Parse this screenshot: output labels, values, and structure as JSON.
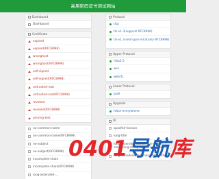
{
  "header": {
    "title": "高用密码证书测试网站"
  },
  "dashboard": {
    "heading": "Dashboard",
    "items": [
      {
        "label": "Dashboard"
      }
    ]
  },
  "certificate": {
    "heading": "Certificate",
    "items": [
      {
        "label": "expired"
      },
      {
        "label": "expired(RFC8998)"
      },
      {
        "label": "wronghost"
      },
      {
        "label": "wronghost(RFC8998)"
      },
      {
        "label": "self-signed"
      },
      {
        "label": "self-signed(RFC8998)"
      },
      {
        "label": "untrusted-root"
      },
      {
        "label": "untrusted-root(RFC8998)"
      },
      {
        "label": "revoked"
      },
      {
        "label": "revoked(RFC8998)"
      },
      {
        "label": "pinning-test"
      }
    ]
  },
  "name_list": {
    "items": [
      {
        "label": "no-common-name"
      },
      {
        "label": "no-common-name(RFC8998)"
      },
      {
        "label": "no-subject"
      },
      {
        "label": "no-subject(RFC8998)"
      },
      {
        "label": "incomplete-chain"
      },
      {
        "label": "incomplete-chain(RFC8998)"
      },
      {
        "label": "long-extended-..."
      }
    ]
  },
  "protocol": {
    "heading": "Protocol",
    "items": [
      {
        "label": "tlcp"
      },
      {
        "label": "tls-v1.3(support RFC8998)"
      },
      {
        "label": "tls-v1.3-sm4-gcm-sm3(only RFC8998)"
      }
    ]
  },
  "upper_protocol": {
    "heading": "Upper Protocol",
    "items": [
      {
        "label": "http2.0"
      },
      {
        "label": "wss"
      },
      {
        "label": "webrtc"
      }
    ]
  },
  "lower_protocol": {
    "heading": "Lower Protocol",
    "items": [
      {
        "label": "ipv6"
      }
    ]
  },
  "upgrade": {
    "heading": "Upgrade",
    "items": [
      {
        "label": "https-everywhere"
      }
    ]
  },
  "ui": {
    "heading": "UI",
    "items": [
      {
        "label": "spoofed-favicon"
      },
      {
        "label": "long-title"
      },
      {
        "label": "long-extended-subdomain-name-containing-many-letters-and-dashes"
      },
      {
        "label": "longextendedsubdomainnamewithout..."
      }
    ]
  },
  "watermark": {
    "text_red_1": "0401",
    "text_blue": "导航",
    "text_red_2": "库"
  }
}
